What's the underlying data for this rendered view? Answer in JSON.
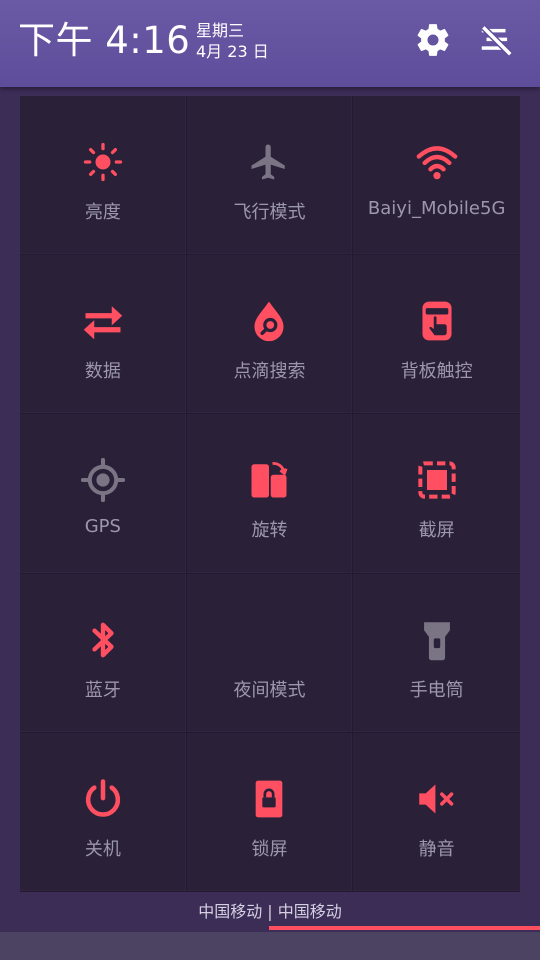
{
  "header": {
    "time": "下午 4:16",
    "weekday": "星期三",
    "date": "4月 23 日"
  },
  "colors": {
    "accent": "#ff4f61",
    "inactive": "#7b7485",
    "label": "#9d97ab"
  },
  "tiles": [
    {
      "label": "亮度",
      "icon": "brightness-icon"
    },
    {
      "label": "飞行模式",
      "icon": "airplane-icon"
    },
    {
      "label": "Baiyi_Mobile5G",
      "icon": "wifi-icon"
    },
    {
      "label": "数据",
      "icon": "data-transfer-icon"
    },
    {
      "label": "点滴搜索",
      "icon": "drop-search-icon"
    },
    {
      "label": "背板触控",
      "icon": "back-touch-icon"
    },
    {
      "label": "GPS",
      "icon": "gps-icon"
    },
    {
      "label": "旋转",
      "icon": "rotate-icon"
    },
    {
      "label": "截屏",
      "icon": "screenshot-icon"
    },
    {
      "label": "蓝牙",
      "icon": "bluetooth-icon"
    },
    {
      "label": "夜间模式",
      "icon": "moon-icon"
    },
    {
      "label": "手电筒",
      "icon": "flashlight-icon"
    },
    {
      "label": "关机",
      "icon": "power-icon"
    },
    {
      "label": "锁屏",
      "icon": "lock-screen-icon"
    },
    {
      "label": "静音",
      "icon": "mute-icon"
    }
  ],
  "carrier": "中国移动 | 中国移动"
}
